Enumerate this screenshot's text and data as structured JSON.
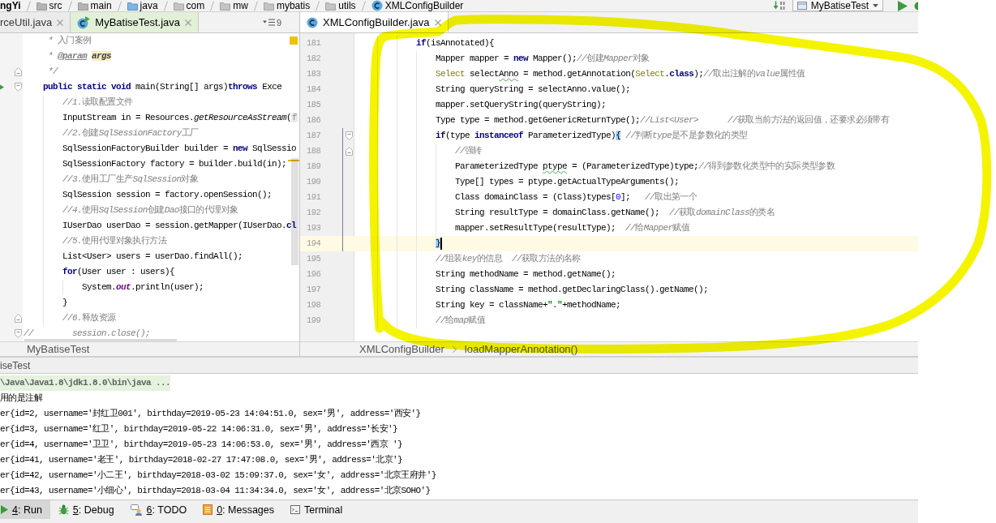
{
  "navigation_bar": {
    "breadcrumbs": [
      {
        "kind": "project",
        "label": "ngYi"
      },
      {
        "kind": "folder",
        "label": "src"
      },
      {
        "kind": "folder",
        "label": "main"
      },
      {
        "kind": "source_folder",
        "label": "java"
      },
      {
        "kind": "package",
        "label": "com"
      },
      {
        "kind": "package",
        "label": "mw"
      },
      {
        "kind": "package",
        "label": "mybatis"
      },
      {
        "kind": "package",
        "label": "utils"
      },
      {
        "kind": "class",
        "label": "XMLConfigBuilder"
      }
    ],
    "run_configuration": "MyBatiseTest"
  },
  "left_editor": {
    "tabs": [
      {
        "kind": "partial",
        "label": "rceUtil.java",
        "selected": false
      },
      {
        "kind": "test_class",
        "label": "MyBatiseTest.java",
        "selected": true,
        "color": "#e3f0d8"
      }
    ],
    "hidden_tab_count": "9",
    "lines": [
      {
        "kind": "code",
        "tokens": [
          {
            "kind": "doc",
            "text": "     * 入门案例"
          }
        ]
      },
      {
        "kind": "code",
        "tokens": [
          {
            "kind": "doc",
            "text": "     * "
          },
          {
            "kind": "doc_tag",
            "text": "@param"
          },
          {
            "kind": "doc_param",
            "text": " args"
          }
        ]
      },
      {
        "kind": "fold_end",
        "tokens": [
          {
            "kind": "doc",
            "text": "     */"
          }
        ]
      },
      {
        "kind": "entry_point",
        "tokens": [
          {
            "kind": "keyword",
            "text": "    public static void"
          },
          {
            "kind": "plain",
            "text": " main(String[] args)"
          },
          {
            "kind": "keyword",
            "text": "throws"
          },
          {
            "kind": "plain",
            "text": " Exce"
          }
        ]
      },
      {
        "kind": "code",
        "tokens": [
          {
            "kind": "comment",
            "text": "        //1.读取配置文件"
          }
        ]
      },
      {
        "kind": "code",
        "tokens": [
          {
            "kind": "plain",
            "text": "        InputStream in = Resources."
          },
          {
            "kind": "static_call",
            "text": "getResourceAsStream"
          },
          {
            "kind": "plain",
            "text": "("
          },
          {
            "kind": "hint",
            "text": "f"
          }
        ]
      },
      {
        "kind": "code",
        "tokens": [
          {
            "kind": "comment",
            "text": "        //2.创建SqlSessionFactory工厂"
          }
        ]
      },
      {
        "kind": "code",
        "tokens": [
          {
            "kind": "plain",
            "text": "        SqlSessionFactoryBuilder builder = "
          },
          {
            "kind": "keyword",
            "text": "new"
          },
          {
            "kind": "plain",
            "text": " SqlSessio"
          }
        ]
      },
      {
        "kind": "code",
        "tokens": [
          {
            "kind": "plain",
            "text": "        SqlSessionFactory factory = builder.build(in);"
          }
        ]
      },
      {
        "kind": "code",
        "tokens": [
          {
            "kind": "comment",
            "text": "        //3.使用工厂生产SqlSession对象"
          }
        ]
      },
      {
        "kind": "code",
        "tokens": [
          {
            "kind": "plain",
            "text": "        SqlSession session = factory.openSession();"
          }
        ]
      },
      {
        "kind": "code",
        "tokens": [
          {
            "kind": "comment",
            "text": "        //4.使用SqlSession创建Dao接口的代理对象"
          }
        ]
      },
      {
        "kind": "code",
        "tokens": [
          {
            "kind": "plain",
            "text": "        IUserDao userDao = session.getMapper(IUserDao."
          },
          {
            "kind": "keyword",
            "text": "cl"
          }
        ]
      },
      {
        "kind": "code",
        "tokens": [
          {
            "kind": "comment",
            "text": "        //5.使用代理对象执行方法"
          }
        ]
      },
      {
        "kind": "code",
        "tokens": [
          {
            "kind": "plain",
            "text": "        List<User> users = userDao.findAll();"
          }
        ]
      },
      {
        "kind": "code",
        "tokens": [
          {
            "kind": "keyword",
            "text": "        for"
          },
          {
            "kind": "plain",
            "text": "(User user : users){"
          }
        ]
      },
      {
        "kind": "code",
        "tokens": [
          {
            "kind": "plain",
            "text": "            System."
          },
          {
            "kind": "static_field",
            "text": "out"
          },
          {
            "kind": "plain",
            "text": ".println(user);"
          }
        ]
      },
      {
        "kind": "code",
        "tokens": [
          {
            "kind": "plain",
            "text": "        }"
          }
        ]
      },
      {
        "kind": "fold_end",
        "tokens": [
          {
            "kind": "comment",
            "text": "        //6.释放资源"
          }
        ]
      },
      {
        "kind": "fold_start",
        "tokens": [
          {
            "kind": "comment",
            "text": "//        session.close();"
          }
        ]
      }
    ],
    "breadcrumbs": [
      "MyBatiseTest"
    ]
  },
  "right_editor": {
    "tabs": [
      {
        "kind": "class",
        "label": "XMLConfigBuilder.java",
        "selected": true
      }
    ],
    "lines": [
      {
        "kind": "code",
        "number": "181",
        "current": false,
        "changed": false,
        "tokens": [
          {
            "kind": "keyword",
            "text": "            if"
          },
          {
            "kind": "plain",
            "text": "(isAnnotated){"
          }
        ]
      },
      {
        "kind": "code",
        "number": "182",
        "current": false,
        "changed": false,
        "tokens": [
          {
            "kind": "plain",
            "text": "                Mapper mapper = "
          },
          {
            "kind": "keyword",
            "text": "new"
          },
          {
            "kind": "plain",
            "text": " Mapper();"
          },
          {
            "kind": "comment",
            "text": "//创建Mapper对象"
          }
        ]
      },
      {
        "kind": "code",
        "number": "183",
        "current": false,
        "changed": false,
        "tokens": [
          {
            "kind": "annotation",
            "text": "                Select"
          },
          {
            "kind": "plain",
            "text": " select"
          },
          {
            "kind": "typo",
            "text": "Anno"
          },
          {
            "kind": "plain",
            "text": " = method.getAnnotation("
          },
          {
            "kind": "annotation",
            "text": "Select"
          },
          {
            "kind": "plain",
            "text": "."
          },
          {
            "kind": "keyword",
            "text": "class"
          },
          {
            "kind": "plain",
            "text": ");"
          },
          {
            "kind": "comment",
            "text": "//取出注解的value属性值"
          }
        ]
      },
      {
        "kind": "code",
        "number": "184",
        "current": false,
        "changed": false,
        "tokens": [
          {
            "kind": "plain",
            "text": "                String queryString = selectAnno.value();"
          }
        ]
      },
      {
        "kind": "code",
        "number": "185",
        "current": false,
        "changed": false,
        "tokens": [
          {
            "kind": "plain",
            "text": "                mapper.setQueryString(queryString);"
          }
        ]
      },
      {
        "kind": "code",
        "number": "186",
        "current": false,
        "changed": false,
        "tokens": [
          {
            "kind": "plain",
            "text": "                Type type = method.getGenericReturnType();"
          },
          {
            "kind": "comment",
            "text": "//List<User>      //获取当前方法的返回值，还要求必须带有"
          }
        ]
      },
      {
        "kind": "fold_start",
        "number": "187",
        "current": false,
        "changed": true,
        "tokens": [
          {
            "kind": "keyword",
            "text": "                if"
          },
          {
            "kind": "plain",
            "text": "(type "
          },
          {
            "kind": "keyword",
            "text": "instanceof"
          },
          {
            "kind": "plain",
            "text": " ParameterizedType)"
          },
          {
            "kind": "brace",
            "text": "{"
          },
          {
            "kind": "comment",
            "text": " //判断type是不是参数化的类型"
          }
        ]
      },
      {
        "kind": "fold_end",
        "number": "188",
        "current": false,
        "changed": true,
        "tokens": [
          {
            "kind": "comment",
            "text": "                    //强转"
          }
        ]
      },
      {
        "kind": "code",
        "number": "189",
        "current": false,
        "changed": true,
        "tokens": [
          {
            "kind": "plain",
            "text": "                    ParameterizedType "
          },
          {
            "kind": "typo",
            "text": "ptype"
          },
          {
            "kind": "plain",
            "text": " = (ParameterizedType)type;"
          },
          {
            "kind": "comment",
            "text": "//得到参数化类型中的实际类型参数"
          }
        ]
      },
      {
        "kind": "code",
        "number": "190",
        "current": false,
        "changed": true,
        "tokens": [
          {
            "kind": "plain",
            "text": "                    Type[] types = ptype.getActualTypeArguments();"
          }
        ]
      },
      {
        "kind": "code",
        "number": "191",
        "current": false,
        "changed": true,
        "tokens": [
          {
            "kind": "plain",
            "text": "                    Class domainClass = (Class)types["
          },
          {
            "kind": "number",
            "text": "0"
          },
          {
            "kind": "plain",
            "text": "];   "
          },
          {
            "kind": "comment",
            "text": "//取出第一个"
          }
        ]
      },
      {
        "kind": "code",
        "number": "192",
        "current": false,
        "changed": true,
        "tokens": [
          {
            "kind": "plain",
            "text": "                    String resultType = domainClass.getName();  "
          },
          {
            "kind": "comment",
            "text": "//获取domainClass的类名"
          }
        ]
      },
      {
        "kind": "code",
        "number": "193",
        "current": false,
        "changed": true,
        "tokens": [
          {
            "kind": "plain",
            "text": "                    mapper.setResultType(resultType);  "
          },
          {
            "kind": "comment",
            "text": "//给Mapper赋值"
          }
        ]
      },
      {
        "kind": "code",
        "number": "194",
        "current": true,
        "changed": true,
        "tokens": [
          {
            "kind": "brace",
            "text": "                }"
          }
        ]
      },
      {
        "kind": "code",
        "number": "195",
        "current": false,
        "changed": false,
        "tokens": [
          {
            "kind": "comment",
            "text": "                //组装key的信息  //获取方法的名称"
          }
        ]
      },
      {
        "kind": "code",
        "number": "196",
        "current": false,
        "changed": false,
        "tokens": [
          {
            "kind": "plain",
            "text": "                String methodName = method.getName();"
          }
        ]
      },
      {
        "kind": "code",
        "number": "197",
        "current": false,
        "changed": false,
        "tokens": [
          {
            "kind": "plain",
            "text": "                String className = method.getDeclaringClass().getName();"
          }
        ]
      },
      {
        "kind": "code",
        "number": "198",
        "current": false,
        "changed": false,
        "tokens": [
          {
            "kind": "plain",
            "text": "                String key = className+"
          },
          {
            "kind": "string",
            "text": "\".\""
          },
          {
            "kind": "plain",
            "text": "+methodName;"
          }
        ]
      },
      {
        "kind": "code",
        "number": "199",
        "current": false,
        "changed": false,
        "tokens": [
          {
            "kind": "comment",
            "text": "                //给map赋值"
          }
        ]
      }
    ],
    "breadcrumbs": [
      "XMLConfigBuilder",
      "loadMapperAnnotation()"
    ]
  },
  "run_window": {
    "title": "iseTest",
    "lines": [
      {
        "kind": "command",
        "text": "\\Java\\Java1.8\\jdk1.8.0\\bin\\java ..."
      },
      {
        "kind": "output",
        "text": "用的是注解"
      },
      {
        "kind": "output",
        "text": "er{id=2, username='封红卫001', birthday=2019-05-23 14:04:51.0, sex='男', address='西安'}"
      },
      {
        "kind": "output",
        "text": "er{id=3, username='红卫', birthday=2019-05-22 14:06:31.0, sex='男', address='长安'}"
      },
      {
        "kind": "output",
        "text": "er{id=4, username='卫卫', birthday=2019-05-23 14:06:53.0, sex='男', address='西京 '}"
      },
      {
        "kind": "output",
        "text": "er{id=41, username='老王', birthday=2018-02-27 17:47:08.0, sex='男', address='北京'}"
      },
      {
        "kind": "output",
        "text": "er{id=42, username='小二王', birthday=2018-03-02 15:09:37.0, sex='女', address='北京王府井'}"
      },
      {
        "kind": "output",
        "text": "er{id=43, username='小细心', birthday=2018-03-04 11:34:34.0, sex='女', address='北京SOHO'}"
      }
    ]
  },
  "tool_window_bar": [
    {
      "kind": "run",
      "mnemonic": "4",
      "label": ": Run",
      "selected": true
    },
    {
      "kind": "debug",
      "mnemonic": "5",
      "label": ": Debug",
      "selected": false
    },
    {
      "kind": "todo",
      "mnemonic": "6",
      "label": ": TODO",
      "selected": false
    },
    {
      "kind": "messages",
      "mnemonic": "0",
      "label": ": Messages",
      "selected": false
    },
    {
      "kind": "terminal",
      "label": "Terminal",
      "selected": false
    }
  ]
}
